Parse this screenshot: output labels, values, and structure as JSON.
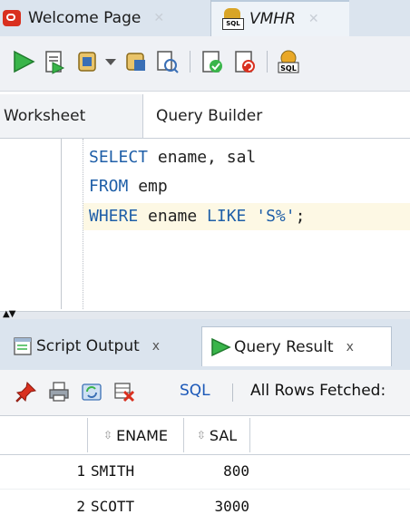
{
  "document_tabs": [
    {
      "label": "Welcome Page",
      "icon": "oracle-icon",
      "active": false
    },
    {
      "label": "VMHR",
      "icon": "sql-worksheet-icon",
      "active": true
    }
  ],
  "toolbar": {
    "icons": [
      "run-statement-icon",
      "run-script-icon",
      "autotrace-icon",
      "dropdown-arrow-icon",
      "explain-plan-icon",
      "sql-tuning-icon",
      "commit-icon",
      "rollback-icon",
      "sql-worksheet-icon"
    ]
  },
  "sub_tabs": [
    {
      "label": "Worksheet",
      "active": true
    },
    {
      "label": "Query Builder",
      "active": false
    }
  ],
  "editor": {
    "lines": [
      {
        "keyword": "SELECT",
        "rest": " ename, sal"
      },
      {
        "keyword": "FROM",
        "rest": " emp"
      },
      {
        "keyword": "WHERE",
        "middle": " ename ",
        "keyword2": "LIKE",
        "space": " ",
        "string": "'S%'",
        "end": ";"
      }
    ]
  },
  "result_tabs": [
    {
      "label": "Script Output",
      "close": "x",
      "active": false
    },
    {
      "label": "Query Result",
      "close": "x",
      "active": true
    }
  ],
  "result_toolbar": {
    "sql_label": "SQL",
    "separator": "|",
    "status": "All Rows Fetched:"
  },
  "grid": {
    "columns": [
      "ENAME",
      "SAL"
    ],
    "rows": [
      {
        "num": "1",
        "ename": "SMITH",
        "sal": "800"
      },
      {
        "num": "2",
        "ename": "SCOTT",
        "sal": "3000"
      }
    ]
  },
  "colors": {
    "tab_strip": "#dbe4ee",
    "keyword": "#1f5fa8",
    "active_line": "#fdf8e4",
    "link": "#1b58b8"
  }
}
